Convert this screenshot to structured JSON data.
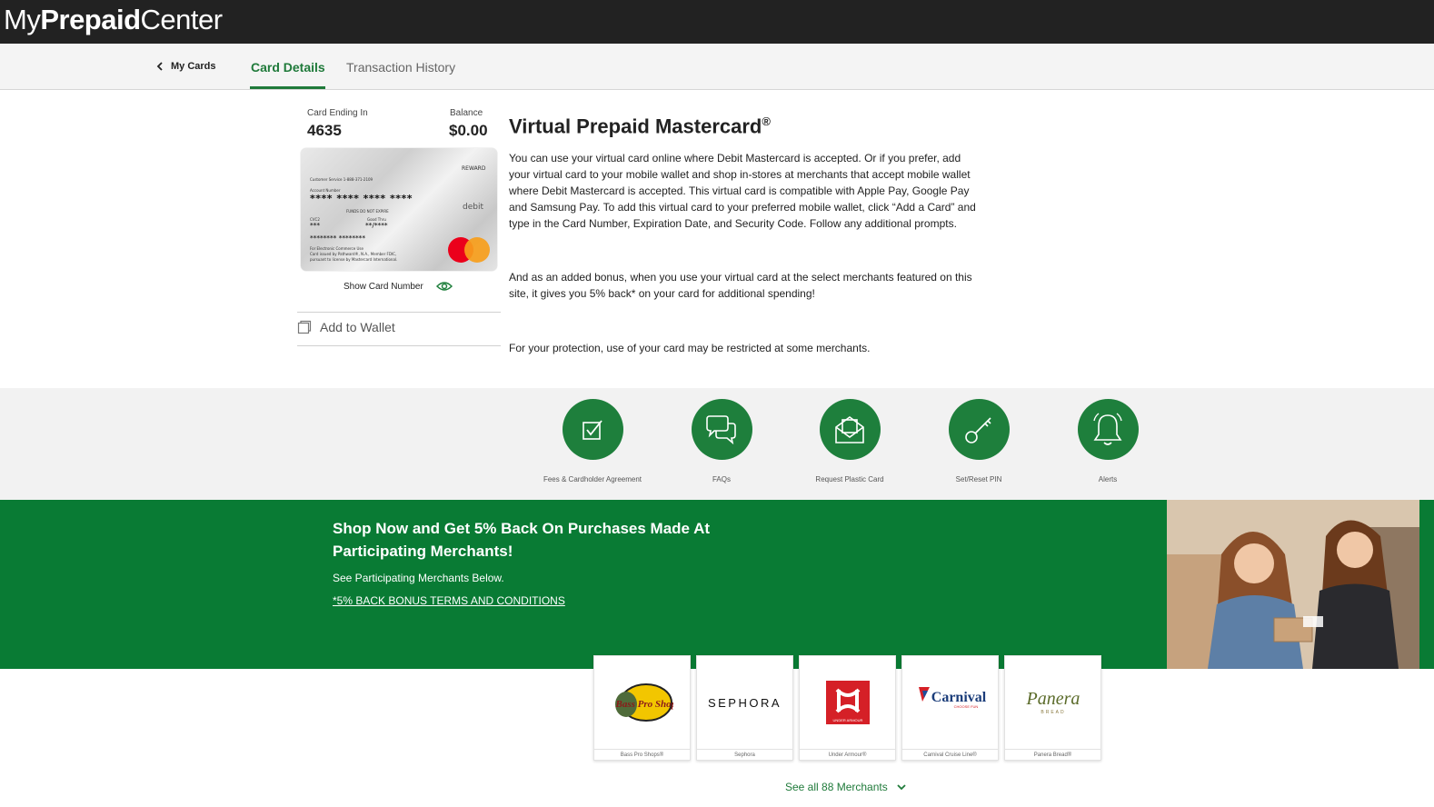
{
  "header": {
    "logo_light_1": "My",
    "logo_bold": "Prepaid",
    "logo_light_2": "Center"
  },
  "nav": {
    "back_label": "My Cards",
    "tabs": [
      "Card Details",
      "Transaction History"
    ],
    "active_tab": "Card Details"
  },
  "card": {
    "ending_label": "Card Ending In",
    "ending_value": "4635",
    "balance_label": "Balance",
    "balance_value": "$0.00",
    "image_text": {
      "reward": "REWARD",
      "customer_service": "Customer Service 1-888-371-2109",
      "account_number_label": "Account Number",
      "account_number": "**** **** **** ****",
      "debit": "debit",
      "funds": "FUNDS DO NOT EXPIRE",
      "cvc2": "CVC2",
      "cvc2_value": "***",
      "good_thru": "Good Thru",
      "good_thru_value": "**/****",
      "name_mask": "******** ********",
      "fine_1": "For Electronic Commerce Use",
      "fine_2": "Card issued by Pathward®, N.A., Member FDIC,",
      "fine_3": "pursuant to license by Mastercard International."
    },
    "show_card_number": "Show Card Number",
    "add_to_wallet": "Add to Wallet"
  },
  "description": {
    "title": "Virtual Prepaid Mastercard",
    "title_sup": "®",
    "p1": "You can use your virtual card online where Debit Mastercard is accepted.  Or if you prefer, add your virtual card to your mobile wallet and shop in-stores at merchants that accept mobile wallet where Debit Mastercard is accepted. This virtual card is compatible with Apple Pay, Google Pay and Samsung Pay.  To add this virtual card to your preferred mobile wallet, click “Add a Card” and type in the Card Number, Expiration Date, and Security Code.  Follow any additional prompts.",
    "p2": "And as an added bonus, when you use your virtual card at the select merchants featured on this site, it gives you 5% back* on your card for additional spending!",
    "p3": "For your protection, use of your card may be restricted at some merchants."
  },
  "features": [
    {
      "label": "Fees & Cardholder Agreement",
      "icon": "checkbox-icon"
    },
    {
      "label": "FAQs",
      "icon": "chat-bubbles-icon"
    },
    {
      "label": "Request Plastic Card",
      "icon": "envelope-card-icon"
    },
    {
      "label": "Set/Reset PIN",
      "icon": "key-icon"
    },
    {
      "label": "Alerts",
      "icon": "bell-icon"
    }
  ],
  "promo": {
    "title": "Shop Now and Get 5% Back On Purchases Made At Participating Merchants!",
    "subtitle": "See Participating Merchants Below.",
    "link": "*5% BACK BONUS TERMS AND CONDITIONS"
  },
  "merchants": [
    {
      "name": "Bass Pro Shops®",
      "logo_text": "Bass Pro Shops"
    },
    {
      "name": "Sephora",
      "logo_text": "SEPHORA"
    },
    {
      "name": "Under Armour®",
      "logo_text": "UNDER ARMOUR"
    },
    {
      "name": "Carnival Cruise Line®",
      "logo_text": "Carnival",
      "logo_sub": "CHOOSE FUN"
    },
    {
      "name": "Panera Bread®",
      "logo_text": "Panera",
      "logo_sub": "BREAD"
    }
  ],
  "see_all": "See all 88 Merchants",
  "colors": {
    "brand_green": "#097b34",
    "header_dark": "#222222",
    "tab_green": "#1f7a3a"
  }
}
